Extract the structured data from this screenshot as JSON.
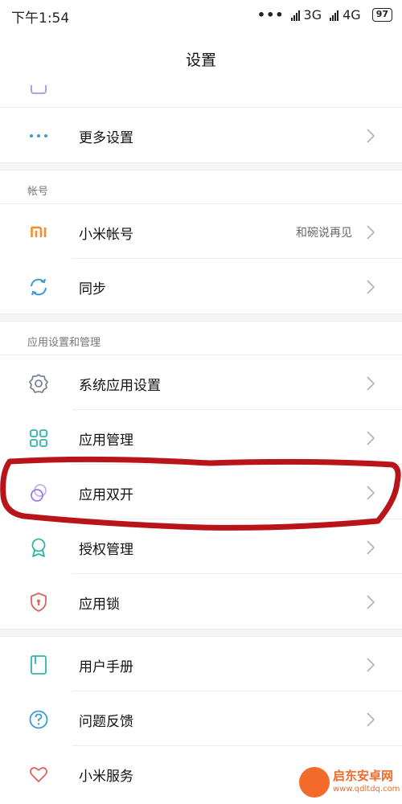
{
  "status_bar": {
    "time": "下午1:54",
    "dots": "•••",
    "net1": "3G",
    "net2": "4G",
    "battery": "97"
  },
  "header": {
    "title": "设置"
  },
  "sections": {
    "more": {
      "label": "更多设置"
    },
    "account": {
      "header": "帐号",
      "mi_account_label": "小米帐号",
      "mi_account_value": "和碗说再见",
      "sync_label": "同步"
    },
    "apps": {
      "header": "应用设置和管理",
      "system_apps_label": "系统应用设置",
      "app_manage_label": "应用管理",
      "dual_apps_label": "应用双开",
      "permissions_label": "授权管理",
      "app_lock_label": "应用锁"
    },
    "help": {
      "manual_label": "用户手册",
      "feedback_label": "问题反馈",
      "mi_service_label": "小米服务"
    }
  },
  "watermark": {
    "title": "启东安卓网",
    "url": "www.qdltdq.com"
  },
  "colors": {
    "accent_orange": "#f88b2b",
    "accent_teal": "#2fb6a8",
    "accent_purple": "#9a7be2",
    "accent_red": "#e06262",
    "annotation_red": "#b8141a"
  }
}
